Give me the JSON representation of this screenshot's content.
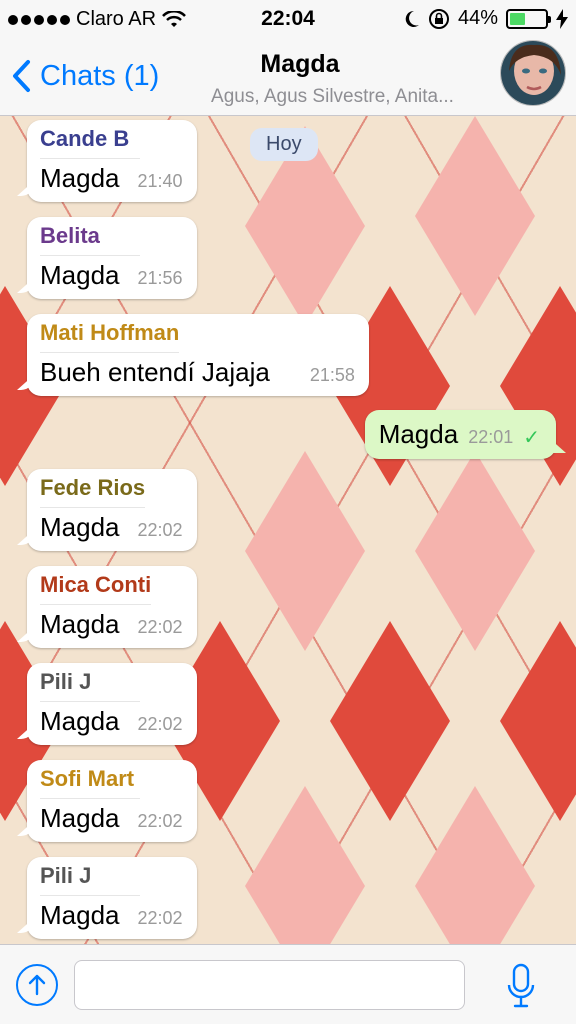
{
  "status_bar": {
    "carrier": "Claro AR",
    "time": "22:04",
    "battery_percent": "44%",
    "battery_level": 0.44,
    "icons": [
      "signal-dots-icon",
      "wifi-icon",
      "moon-icon",
      "rotation-lock-icon",
      "battery-icon",
      "charging-bolt-icon"
    ]
  },
  "nav": {
    "back_label": "Chats (1)",
    "title": "Magda",
    "subtitle": "Agus, Agus Silvestre, Anita..."
  },
  "chat": {
    "day_label": "Hoy",
    "incoming": [
      {
        "sender": "Cande B",
        "sender_color": "#3a3f8f",
        "text": "Magda",
        "time": "21:40"
      },
      {
        "sender": "Belita",
        "sender_color": "#6b3a8c",
        "text": "Magda",
        "time": "21:56"
      },
      {
        "sender": "Mati Hoffman",
        "sender_color": "#c08a17",
        "text": "Bueh entendí Jajaja",
        "time": "21:58"
      },
      {
        "sender": "Fede Rios",
        "sender_color": "#7a6a1a",
        "text": "Magda",
        "time": "22:02"
      },
      {
        "sender": "Mica Conti",
        "sender_color": "#b23a1a",
        "text": "Magda",
        "time": "22:02"
      },
      {
        "sender": "Pili J",
        "sender_color": "#555555",
        "text": "Magda",
        "time": "22:02"
      },
      {
        "sender": "Sofi Mart",
        "sender_color": "#c08a17",
        "text": "Magda",
        "time": "22:02"
      },
      {
        "sender": "Pili J",
        "sender_color": "#555555",
        "text": "Magda",
        "time": "22:02"
      }
    ],
    "outgoing": {
      "text": "Magda",
      "time": "22:01",
      "status_icon": "check-icon"
    }
  },
  "input": {
    "value": "",
    "placeholder": ""
  },
  "colors": {
    "accent": "#007aff",
    "outgoing_bubble": "#dcf8c6",
    "incoming_bubble": "#ffffff",
    "read_check": "#34c759"
  }
}
